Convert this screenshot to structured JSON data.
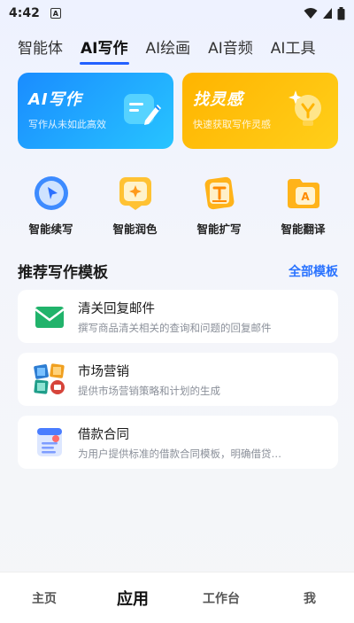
{
  "status": {
    "time": "4:42",
    "app_badge": "A"
  },
  "tabs": [
    {
      "label": "智能体"
    },
    {
      "label": "AI写作"
    },
    {
      "label": "AI绘画"
    },
    {
      "label": "AI音频"
    },
    {
      "label": "AI工具"
    }
  ],
  "active_tab": "AI写作",
  "banner_cards": [
    {
      "title": "AI写作",
      "subtitle": "写作从未如此高效",
      "color": "#1a8cff"
    },
    {
      "title": "找灵感",
      "subtitle": "快速获取写作灵感",
      "color": "#ffb400"
    }
  ],
  "features": [
    {
      "label": "智能续写",
      "icon": "cursor-icon"
    },
    {
      "label": "智能润色",
      "icon": "polish-icon"
    },
    {
      "label": "智能扩写",
      "icon": "expand-text-icon"
    },
    {
      "label": "智能翻译",
      "icon": "translate-folder-icon"
    }
  ],
  "section": {
    "title": "推荐写作模板",
    "link": "全部模板"
  },
  "templates": [
    {
      "title": "清关回复邮件",
      "desc": "撰写商品清关相关的查询和问题的回复邮件",
      "icon": "email-icon"
    },
    {
      "title": "市场营销",
      "desc": "提供市场营销策略和计划的生成",
      "icon": "marketing-icon"
    },
    {
      "title": "借款合同",
      "desc": "为用户提供标准的借款合同模板，明确借贷…",
      "icon": "contract-icon"
    }
  ],
  "bottom_nav": [
    {
      "label": "主页"
    },
    {
      "label": "应用"
    },
    {
      "label": "工作台"
    },
    {
      "label": "我"
    }
  ],
  "active_nav": "应用",
  "colors": {
    "accent": "#2260ff",
    "link": "#2a73ff"
  }
}
